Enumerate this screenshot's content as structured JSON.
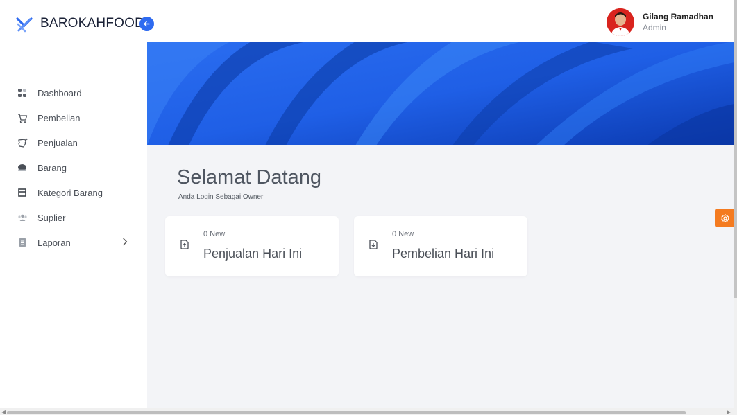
{
  "brand": {
    "name": "BAROKAHFOOD"
  },
  "user": {
    "name": "Gilang Ramadhan",
    "role": "Admin"
  },
  "sidebar": {
    "items": [
      {
        "label": "Dashboard",
        "icon": "dashboard-icon"
      },
      {
        "label": "Pembelian",
        "icon": "cart-icon"
      },
      {
        "label": "Penjualan",
        "icon": "ticket-icon"
      },
      {
        "label": "Barang",
        "icon": "box-icon"
      },
      {
        "label": "Kategori Barang",
        "icon": "category-icon"
      },
      {
        "label": "Suplier",
        "icon": "users-icon"
      },
      {
        "label": "Laporan",
        "icon": "report-icon",
        "has_submenu": true
      }
    ]
  },
  "main": {
    "title": "Selamat Datang",
    "subtitle": "Anda Login Sebagai Owner",
    "cards": [
      {
        "count_label": "0 New",
        "title": "Penjualan Hari Ini",
        "icon": "file-upload-icon"
      },
      {
        "count_label": "0 New",
        "title": "Pembelian Hari Ini",
        "icon": "file-download-icon"
      }
    ]
  },
  "colors": {
    "accent": "#2f6bf0",
    "banner_dark": "#0a3fb8",
    "banner_light": "#2d7cf2",
    "settings": "#f47b20"
  }
}
